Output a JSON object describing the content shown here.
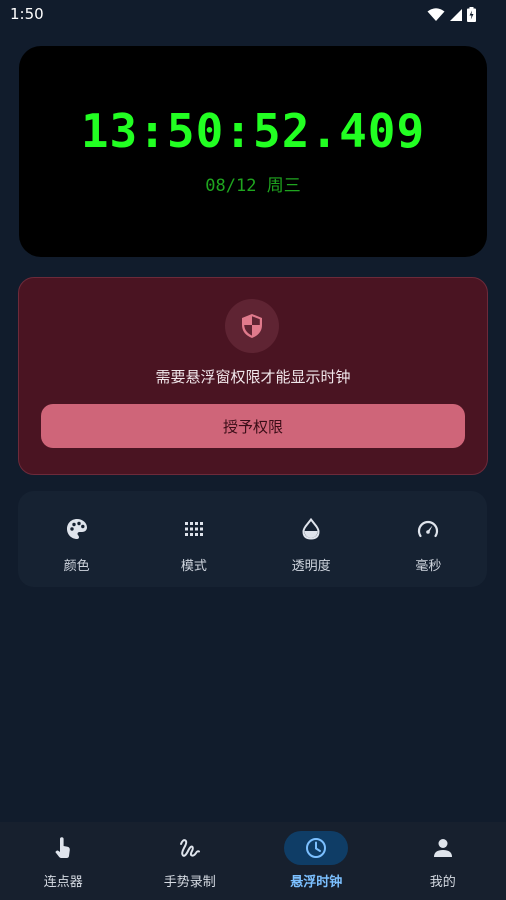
{
  "status_bar": {
    "time": "1:50",
    "icons": [
      "wifi-icon",
      "signal-icon",
      "battery-charging-icon"
    ]
  },
  "clock": {
    "time": "13:50:52.409",
    "date": "08/12  周三",
    "time_color": "#22ff22",
    "date_color": "#1fa51f"
  },
  "permission": {
    "icon": "shield-icon",
    "message": "需要悬浮窗权限才能显示时钟",
    "button_label": "授予权限",
    "button_color": "#cf6579"
  },
  "options": [
    {
      "label": "颜色",
      "icon": "palette-icon"
    },
    {
      "label": "模式",
      "icon": "grid-icon"
    },
    {
      "label": "透明度",
      "icon": "opacity-icon"
    },
    {
      "label": "毫秒",
      "icon": "speedometer-icon"
    }
  ],
  "nav": {
    "items": [
      {
        "label": "连点器",
        "icon": "tap-icon"
      },
      {
        "label": "手势录制",
        "icon": "gesture-icon"
      },
      {
        "label": "悬浮时钟",
        "icon": "clock-icon",
        "active": true
      },
      {
        "label": "我的",
        "icon": "person-icon"
      }
    ],
    "active_color": "#7cc0ff"
  }
}
